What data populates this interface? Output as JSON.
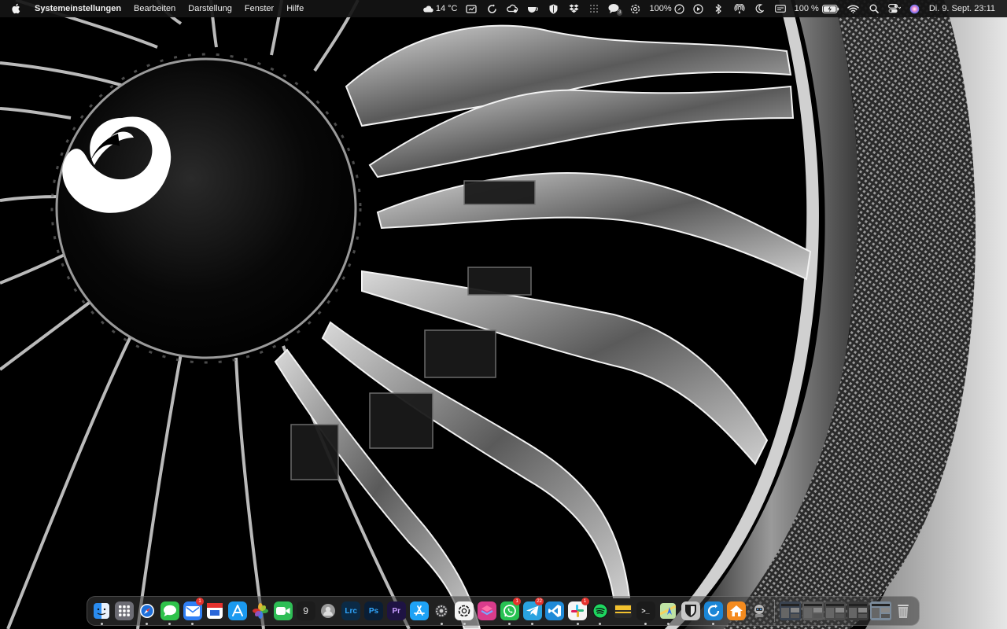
{
  "menubar": {
    "app_name": "Systemeinstellungen",
    "menus": [
      "Bearbeiten",
      "Darstellung",
      "Fenster",
      "Hilfe"
    ],
    "weather": "14 °C",
    "cpu_percent": "100%",
    "battery_percent": "100 %",
    "messages_badge": "3",
    "clock": "Di. 9. Sept. 23:11"
  },
  "dock": {
    "items": [
      {
        "name": "finder",
        "label": "",
        "color": "#2a8cf0",
        "running": true
      },
      {
        "name": "launchpad",
        "label": "",
        "color": "#6c6c74",
        "running": false
      },
      {
        "name": "safari",
        "label": "",
        "color": "#1e6fd9",
        "running": true
      },
      {
        "name": "messages",
        "label": "",
        "color": "#2fc24b",
        "running": true
      },
      {
        "name": "mail",
        "label": "",
        "color": "#2f7ff5",
        "running": true,
        "badge": "1"
      },
      {
        "name": "calendar",
        "label": "",
        "color": "#ffffff",
        "running": false
      },
      {
        "name": "app-store-alt",
        "label": "",
        "color": "#1b9af0",
        "running": false
      },
      {
        "name": "photos",
        "label": "",
        "color": "#f3a33a",
        "running": false
      },
      {
        "name": "facetime",
        "label": "",
        "color": "#2ebd55",
        "running": false
      },
      {
        "name": "nine-app",
        "label": "9",
        "color": "#1c1c1c",
        "running": false
      },
      {
        "name": "accounts",
        "label": "",
        "color": "#707070",
        "running": false
      },
      {
        "name": "lightroom-classic",
        "label": "Lrc",
        "color": "#0b2a45",
        "running": false
      },
      {
        "name": "photoshop",
        "label": "Ps",
        "color": "#0a1e35",
        "running": false
      },
      {
        "name": "premiere",
        "label": "Pr",
        "color": "#1e1343",
        "running": false
      },
      {
        "name": "app-store",
        "label": "",
        "color": "#1ea2f5",
        "running": false
      },
      {
        "name": "system-settings",
        "label": "",
        "color": "#8c8c92",
        "running": true
      },
      {
        "name": "chatgpt",
        "label": "",
        "color": "#f4f4f4",
        "running": true
      },
      {
        "name": "shortcuts",
        "label": "",
        "color": "#d93c8c",
        "running": false
      },
      {
        "name": "whatsapp",
        "label": "",
        "color": "#27c252",
        "running": true,
        "badge": "1"
      },
      {
        "name": "telegram",
        "label": "",
        "color": "#2aa3e0",
        "running": true,
        "badge": "22"
      },
      {
        "name": "vscode",
        "label": "",
        "color": "#1f8ad8",
        "running": false
      },
      {
        "name": "slack",
        "label": "",
        "color": "#f5f5f5",
        "running": true,
        "badge": "1"
      },
      {
        "name": "spotify",
        "label": "",
        "color": "#1ed760",
        "running": true
      },
      {
        "name": "notes-bar",
        "label": "",
        "color": "#f2c12e",
        "running": false
      },
      {
        "name": "terminal",
        "label": ">_",
        "color": "#1b1b1b",
        "running": true
      },
      {
        "name": "maps",
        "label": "",
        "color": "#5cc47a",
        "running": true
      },
      {
        "name": "bitwarden",
        "label": "",
        "color": "#c9c9c9",
        "running": false
      },
      {
        "name": "sync-app",
        "label": "",
        "color": "#1b86d6",
        "running": true
      },
      {
        "name": "home",
        "label": "",
        "color": "#f48b1f",
        "running": false
      },
      {
        "name": "automator",
        "label": "",
        "color": "#e8e8e8",
        "running": false
      }
    ],
    "minimized": [
      {
        "name": "minimized-window-1",
        "color": "#3a4350"
      },
      {
        "name": "minimized-window-2",
        "color": "#5a5a5a"
      },
      {
        "name": "minimized-window-3",
        "color": "#4a4a4a"
      },
      {
        "name": "minimized-window-4",
        "color": "#3a3a3a"
      },
      {
        "name": "minimized-window-5",
        "color": "#7a8a9a"
      }
    ],
    "trash": {
      "name": "trash",
      "color": "#8a8a8a"
    }
  }
}
